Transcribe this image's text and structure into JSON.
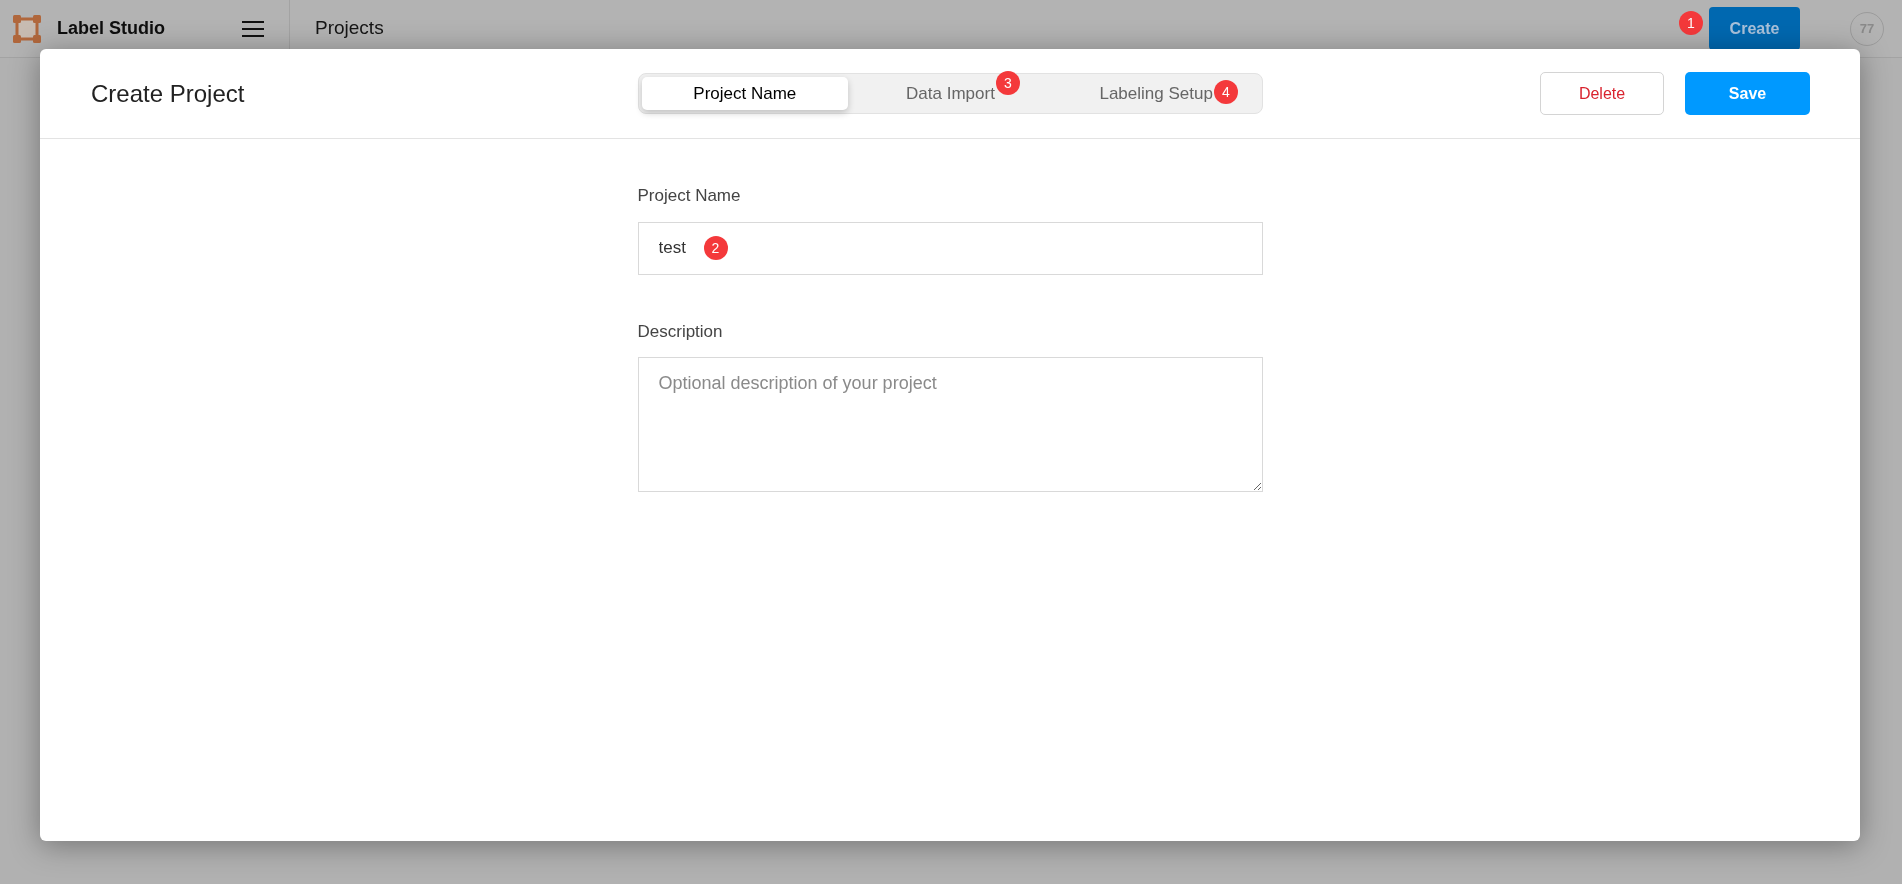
{
  "app": {
    "name": "Label Studio",
    "page_title": "Projects",
    "create_button": {
      "label": "Create",
      "marker": "1"
    },
    "avatar": {
      "initials": "77"
    }
  },
  "dialog": {
    "title": "Create Project",
    "steps": [
      {
        "label": "Project Name",
        "selected": true
      },
      {
        "label": "Data Import",
        "selected": false,
        "marker": "3"
      },
      {
        "label": "Labeling Setup",
        "selected": false,
        "marker": "4"
      }
    ],
    "buttons": [
      {
        "kind": "delete",
        "label": "Delete"
      },
      {
        "kind": "save",
        "label": "Save"
      }
    ],
    "fields": [
      {
        "kind": "input",
        "label": "Project Name",
        "value": "test",
        "marker": "2"
      },
      {
        "kind": "textarea",
        "label": "Description",
        "placeholder": "Optional description of your project"
      }
    ]
  }
}
